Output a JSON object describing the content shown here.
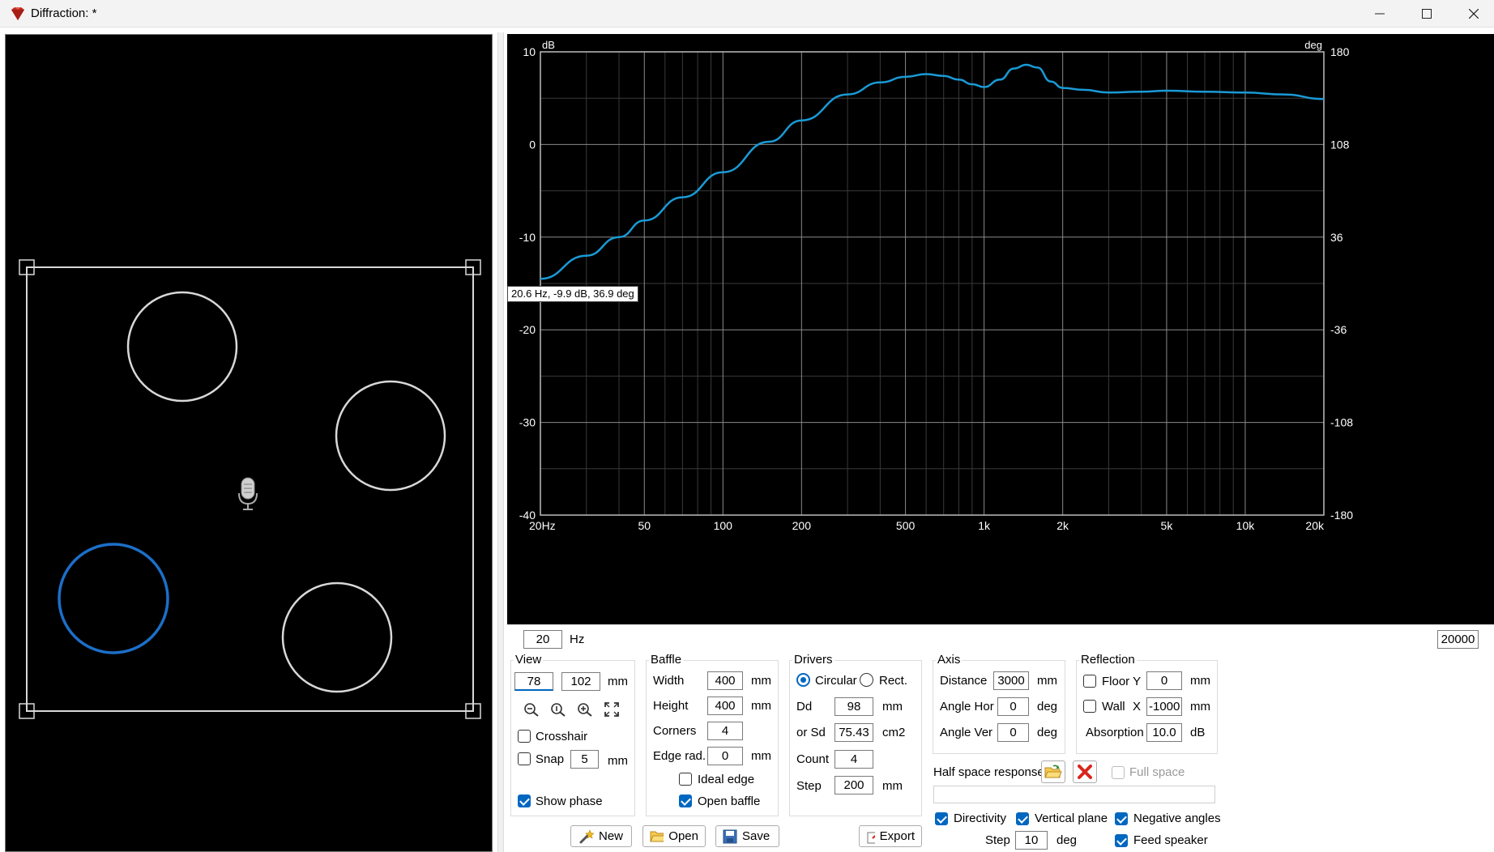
{
  "window": {
    "title": "Diffraction: *"
  },
  "tooltip": "20.6 Hz, -9.9 dB, 36.9 deg",
  "chart_data": {
    "type": "line",
    "x_scale": "log",
    "xlim": [
      20,
      20000
    ],
    "ylim": [
      -40,
      10
    ],
    "y2lim": [
      -180,
      180
    ],
    "ylabel": "dB",
    "y2label": "deg",
    "xticks": [
      20,
      50,
      100,
      200,
      500,
      1000,
      2000,
      5000,
      10000,
      20000
    ],
    "xtick_labels": [
      "20Hz",
      "50",
      "100",
      "200",
      "500",
      "1k",
      "2k",
      "5k",
      "10k",
      "20k"
    ],
    "yticks": [
      10,
      0,
      -10,
      -20,
      -30,
      -40
    ],
    "y2ticks": [
      "180",
      "108",
      "36",
      "-36",
      "-108",
      "-180"
    ],
    "grid": true,
    "line_color": "#1a9ad6",
    "series": [
      {
        "x": [
          20,
          30,
          40,
          50,
          70,
          100,
          150,
          200,
          300,
          400,
          500,
          600,
          700,
          800,
          900,
          1000,
          1150,
          1300,
          1450,
          1600,
          1800,
          2000,
          2400,
          3000,
          4000,
          5000,
          7000,
          10000,
          14000,
          20000
        ],
        "y": [
          -14.5,
          -12.0,
          -10.0,
          -8.2,
          -5.7,
          -3.0,
          0.3,
          2.6,
          5.4,
          6.7,
          7.3,
          7.6,
          7.4,
          7.0,
          6.5,
          6.2,
          7.0,
          8.2,
          8.6,
          8.3,
          6.8,
          6.1,
          5.9,
          5.6,
          5.7,
          5.8,
          5.7,
          5.6,
          5.4,
          4.9
        ]
      }
    ]
  },
  "plot_range": {
    "from": "20",
    "unit": "Hz",
    "to": "20000"
  },
  "view": {
    "title": "View",
    "x_value": "78",
    "y_value": "102",
    "unit": "mm",
    "tool_icons": [
      "zoom-out-icon",
      "zoom-fit-icon",
      "zoom-in-icon",
      "fullscreen-icon"
    ],
    "crosshair": {
      "label": "Crosshair",
      "checked": false
    },
    "snap": {
      "label": "Snap",
      "value": "5",
      "unit": "mm",
      "checked": false
    },
    "show_phase": {
      "label": "Show phase",
      "checked": true
    }
  },
  "baffle": {
    "title": "Baffle",
    "width": {
      "label": "Width",
      "value": "400",
      "unit": "mm"
    },
    "height": {
      "label": "Height",
      "value": "400",
      "unit": "mm"
    },
    "corners": {
      "label": "Corners",
      "value": "4"
    },
    "edge_rad": {
      "label": "Edge rad.",
      "value": "0",
      "unit": "mm"
    },
    "ideal_edge": {
      "label": "Ideal edge",
      "checked": false
    },
    "open_baffle": {
      "label": "Open baffle",
      "checked": true
    }
  },
  "drivers": {
    "title": "Drivers",
    "circular": {
      "label": "Circular",
      "selected": true
    },
    "rect": {
      "label": "Rect.",
      "selected": false
    },
    "dd": {
      "label": "Dd",
      "value": "98",
      "unit": "mm"
    },
    "sd": {
      "label": "or Sd",
      "value": "75.43",
      "unit": "cm2"
    },
    "count": {
      "label": "Count",
      "value": "4"
    },
    "step": {
      "label": "Step",
      "value": "200",
      "unit": "mm"
    }
  },
  "axis": {
    "title": "Axis",
    "distance": {
      "label": "Distance",
      "value": "3000",
      "unit": "mm"
    },
    "angle_hor": {
      "label": "Angle Hor",
      "value": "0",
      "unit": "deg"
    },
    "angle_ver": {
      "label": "Angle Ver",
      "value": "0",
      "unit": "deg"
    }
  },
  "reflection": {
    "title": "Reflection",
    "floor": {
      "label": "Floor Y",
      "value": "0",
      "unit": "mm",
      "checked": false
    },
    "wall": {
      "label": "Wall",
      "axis": "X",
      "value": "-1000",
      "unit": "mm",
      "checked": false
    },
    "absorption": {
      "label": "Absorption",
      "value": "10.0",
      "unit": "dB"
    }
  },
  "half_space": {
    "label": "Half space response",
    "path": "",
    "full_space": {
      "label": "Full space",
      "checked": false,
      "enabled": false
    }
  },
  "directivity": {
    "directivity": {
      "label": "Directivity",
      "checked": true
    },
    "vertical_plane": {
      "label": "Vertical plane",
      "checked": true
    },
    "negative_angles": {
      "label": "Negative angles",
      "checked": true
    },
    "step": {
      "label": "Step",
      "value": "10",
      "unit": "deg"
    },
    "feed_speaker": {
      "label": "Feed speaker",
      "checked": true
    }
  },
  "actions": {
    "new": "New",
    "open": "Open",
    "save": "Save",
    "export": "Export"
  },
  "scene": {
    "selected_color": "#1c6fc8",
    "outline_color": "#d8d8d8",
    "driver_count": 4,
    "selected_driver": 3
  }
}
